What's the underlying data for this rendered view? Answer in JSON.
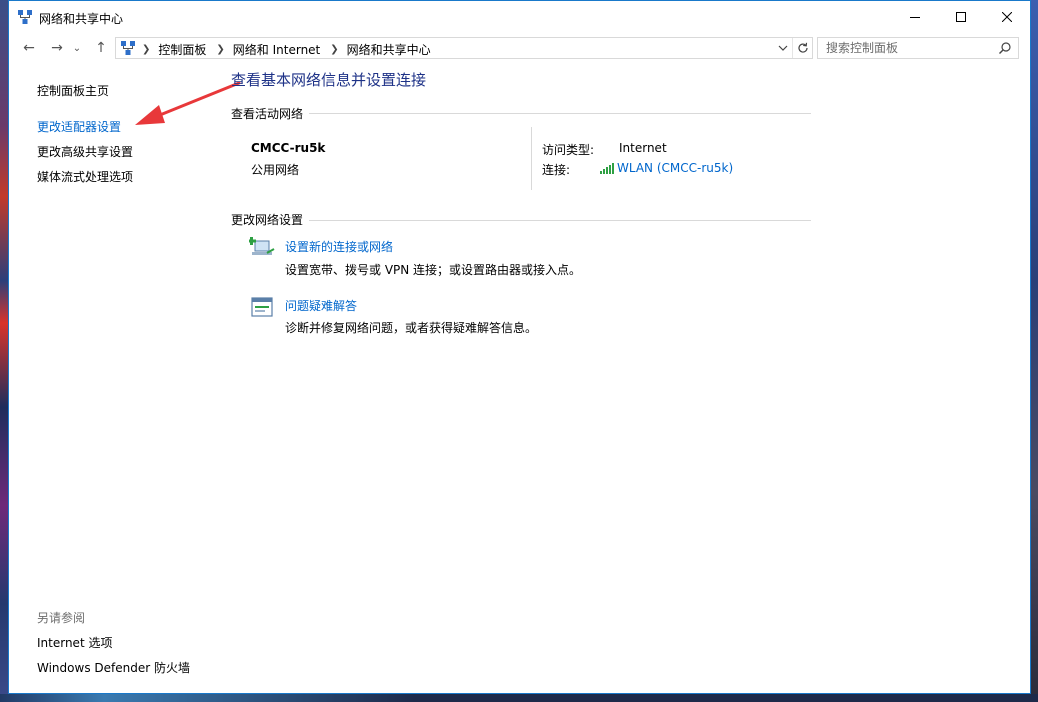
{
  "window": {
    "title": "网络和共享中心",
    "controls": {
      "minimize": "—",
      "maximize": "☐",
      "close": "✕"
    }
  },
  "nav": {
    "back": "←",
    "forward": "→",
    "recent": "⌄",
    "up": "↑",
    "breadcrumb": [
      "控制面板",
      "网络和 Internet",
      "网络和共享中心"
    ],
    "search_placeholder": "搜索控制面板"
  },
  "sidebar": {
    "items": [
      {
        "label": "控制面板主页"
      },
      {
        "label": "更改适配器设置"
      },
      {
        "label": "更改高级共享设置"
      },
      {
        "label": "媒体流式处理选项"
      }
    ],
    "see_also_heading": "另请参阅",
    "see_also": [
      {
        "label": "Internet 选项"
      },
      {
        "label": "Windows Defender 防火墙"
      }
    ]
  },
  "main": {
    "title": "查看基本网络信息并设置连接",
    "active_networks_heading": "查看活动网络",
    "network": {
      "name": "CMCC-ru5k",
      "type": "公用网络",
      "access_type_label": "访问类型:",
      "access_type_value": "Internet",
      "connection_label": "连接:",
      "connection_value": "WLAN (CMCC-ru5k)"
    },
    "change_settings_heading": "更改网络设置",
    "tasks": [
      {
        "link": "设置新的连接或网络",
        "description": "设置宽带、拨号或 VPN 连接；或设置路由器或接入点。",
        "icon": "new-connection-icon"
      },
      {
        "link": "问题疑难解答",
        "description": "诊断并修复网络问题，或者获得疑难解答信息。",
        "icon": "troubleshoot-icon"
      }
    ]
  },
  "colors": {
    "link": "#0066cc",
    "title": "#1e3287",
    "annotation_arrow": "#e8383a",
    "window_border": "#1979ca"
  }
}
